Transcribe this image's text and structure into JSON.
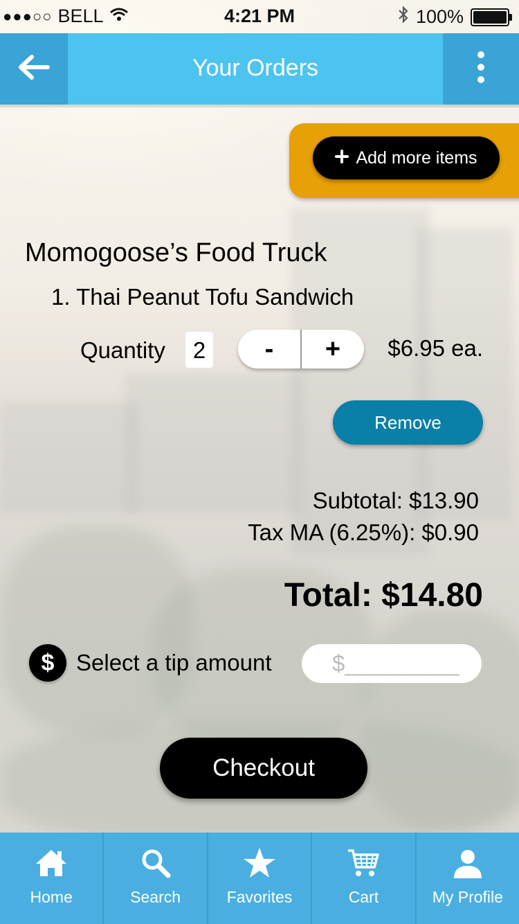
{
  "status_bar": {
    "signal": "●●●○○",
    "carrier": "BELL",
    "time": "4:21 PM",
    "battery": "100%"
  },
  "header": {
    "title": "Your Orders",
    "back_icon": "arrow-left-icon",
    "more_icon": "more-vertical-icon"
  },
  "actions": {
    "add_more_label": "Add more items"
  },
  "order": {
    "vendor": "Momogoose’s Food Truck",
    "items": [
      {
        "label": "1. Thai Peanut Tofu Sandwich",
        "quantity_label": "Quantity",
        "quantity": "2",
        "decrement": "-",
        "increment": "+",
        "price": "$6.95 ea.",
        "remove_label": "Remove"
      }
    ]
  },
  "summary": {
    "subtotal": "Subtotal: $13.90",
    "tax": "Tax MA (6.25%): $0.90",
    "total": "Total: $14.80"
  },
  "tip": {
    "icon_symbol": "$",
    "label": "Select a tip amount",
    "placeholder": "$_________"
  },
  "checkout_label": "Checkout",
  "tabbar": {
    "tabs": [
      {
        "label": "Home",
        "icon": "home-icon"
      },
      {
        "label": "Search",
        "icon": "search-icon"
      },
      {
        "label": "Favorites",
        "icon": "star-icon"
      },
      {
        "label": "Cart",
        "icon": "cart-icon"
      },
      {
        "label": "My Profile",
        "icon": "profile-icon"
      }
    ]
  },
  "colors": {
    "header": "#4dc4ef",
    "header_accent": "#3aa4d6",
    "add_panel": "#e7a005",
    "remove_button": "#0a7fa7",
    "tabbar": "#4aafe0"
  }
}
